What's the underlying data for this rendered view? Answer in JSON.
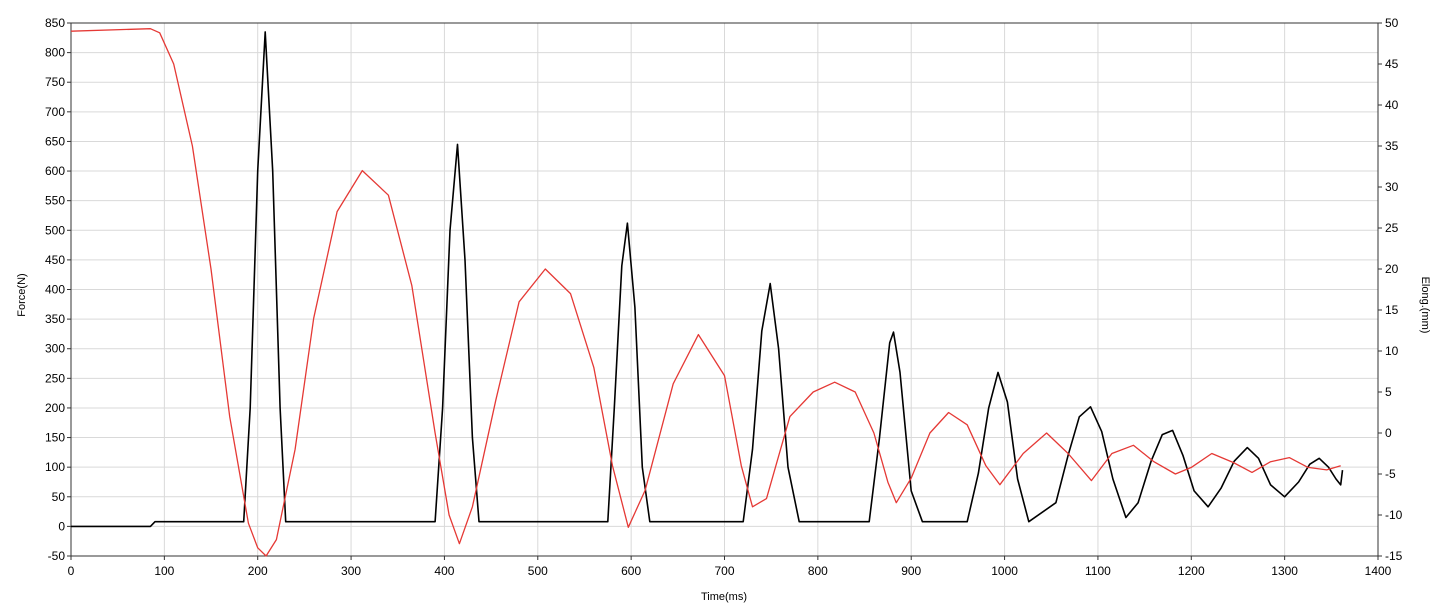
{
  "chart_data": {
    "type": "line",
    "xlabel": "Time(ms)",
    "ylabel_left": "Force(N)",
    "ylabel_right": "Elong.(mm)",
    "xlim": [
      0,
      1400
    ],
    "ylim_left": [
      -50,
      850
    ],
    "ylim_right": [
      -15,
      50
    ],
    "x_ticks": [
      0,
      100,
      200,
      300,
      400,
      500,
      600,
      700,
      800,
      900,
      1000,
      1100,
      1200,
      1300,
      1400
    ],
    "y_left_ticks": [
      -50,
      0,
      50,
      100,
      150,
      200,
      250,
      300,
      350,
      400,
      450,
      500,
      550,
      600,
      650,
      700,
      750,
      800,
      850
    ],
    "y_right_ticks": [
      -15,
      -10,
      -5,
      0,
      5,
      10,
      15,
      20,
      25,
      30,
      35,
      40,
      45,
      50
    ],
    "grid": true,
    "series": [
      {
        "color": "#000000",
        "axis": "left",
        "x": [
          0,
          85,
          90,
          185,
          192,
          200,
          208,
          216,
          224,
          230,
          390,
          398,
          406,
          414,
          422,
          430,
          437,
          575,
          582,
          590,
          596,
          604,
          612,
          620,
          720,
          730,
          740,
          749,
          758,
          768,
          780,
          855,
          866,
          877,
          881,
          888,
          900,
          912,
          960,
          972,
          983,
          993,
          1003,
          1014,
          1026,
          1055,
          1068,
          1080,
          1092,
          1104,
          1116,
          1130,
          1143,
          1157,
          1169,
          1180,
          1191,
          1203,
          1218,
          1232,
          1246,
          1260,
          1272,
          1285,
          1300,
          1315,
          1327,
          1337,
          1347,
          1355,
          1360,
          1362
        ],
        "values": [
          0,
          0,
          8,
          8,
          200,
          600,
          835,
          600,
          200,
          8,
          8,
          200,
          500,
          645,
          450,
          150,
          8,
          8,
          200,
          440,
          512,
          370,
          100,
          8,
          8,
          130,
          330,
          410,
          300,
          100,
          8,
          8,
          150,
          310,
          328,
          260,
          60,
          8,
          8,
          90,
          200,
          260,
          210,
          80,
          8,
          40,
          120,
          185,
          202,
          160,
          80,
          15,
          40,
          110,
          155,
          162,
          120,
          60,
          33,
          65,
          110,
          133,
          115,
          70,
          50,
          75,
          105,
          115,
          100,
          80,
          70,
          95
        ]
      },
      {
        "color": "#e53935",
        "axis": "right",
        "x": [
          0,
          85,
          95,
          110,
          130,
          150,
          170,
          190,
          200,
          209,
          220,
          240,
          260,
          285,
          312,
          340,
          365,
          390,
          405,
          416,
          430,
          455,
          480,
          508,
          535,
          560,
          580,
          597,
          615,
          645,
          672,
          700,
          718,
          730,
          745,
          770,
          795,
          818,
          840,
          860,
          875,
          884,
          900,
          920,
          940,
          960,
          980,
          995,
          1020,
          1045,
          1068,
          1093,
          1115,
          1138,
          1160,
          1183,
          1200,
          1222,
          1245,
          1265,
          1285,
          1305,
          1325,
          1345,
          1360
        ],
        "values": [
          49,
          49.3,
          48.8,
          45,
          35,
          20,
          2,
          -11,
          -14,
          -15,
          -13,
          -2,
          14,
          27,
          32,
          29,
          18,
          0,
          -10,
          -13.5,
          -9,
          4,
          16,
          20,
          17,
          8,
          -4,
          -11.5,
          -7,
          6,
          12,
          7,
          -4,
          -9,
          -8,
          2,
          5,
          6.2,
          5,
          0,
          -6,
          -8.5,
          -5.5,
          0,
          2.5,
          1,
          -4,
          -6.3,
          -2.5,
          0,
          -2.5,
          -5.8,
          -2.5,
          -1.5,
          -3.5,
          -5,
          -4.2,
          -2.5,
          -3.6,
          -4.8,
          -3.5,
          -3,
          -4.2,
          -4.5,
          -4
        ]
      }
    ]
  }
}
